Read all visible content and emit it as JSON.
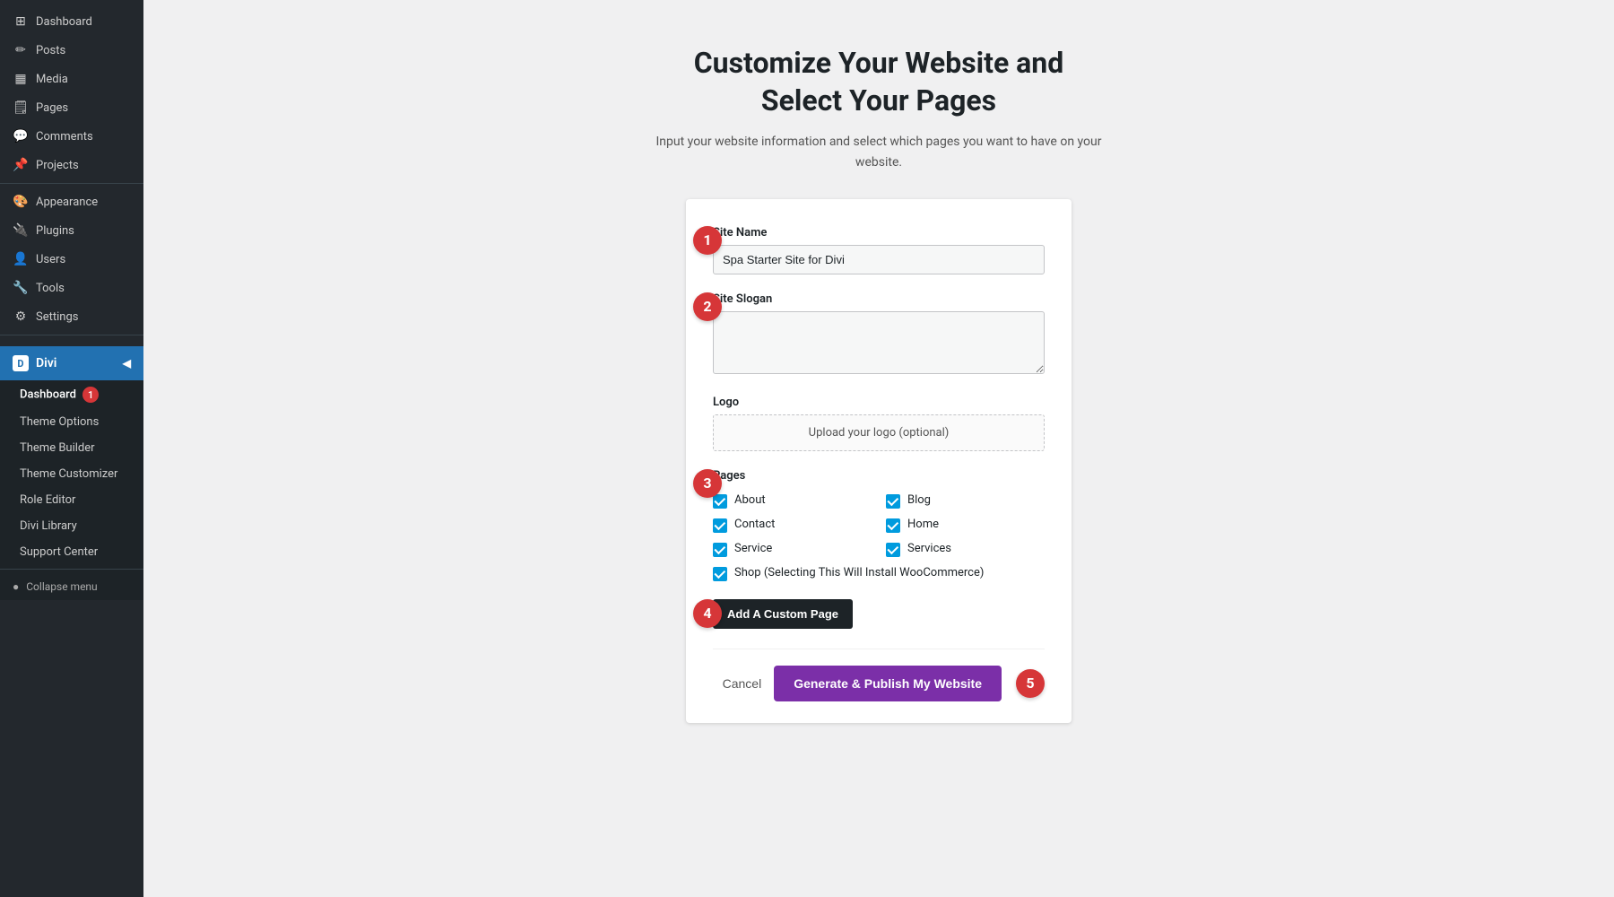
{
  "sidebar": {
    "items": [
      {
        "id": "dashboard",
        "label": "Dashboard",
        "icon": "⊞"
      },
      {
        "id": "posts",
        "label": "Posts",
        "icon": "✏"
      },
      {
        "id": "media",
        "label": "Media",
        "icon": "⬛"
      },
      {
        "id": "pages",
        "label": "Pages",
        "icon": "📄"
      },
      {
        "id": "comments",
        "label": "Comments",
        "icon": "💬"
      },
      {
        "id": "projects",
        "label": "Projects",
        "icon": "📌"
      },
      {
        "id": "appearance",
        "label": "Appearance",
        "icon": "🎨"
      },
      {
        "id": "plugins",
        "label": "Plugins",
        "icon": "🔌"
      },
      {
        "id": "users",
        "label": "Users",
        "icon": "👤"
      },
      {
        "id": "tools",
        "label": "Tools",
        "icon": "🔧"
      },
      {
        "id": "settings",
        "label": "Settings",
        "icon": "⚙"
      }
    ],
    "divi_label": "Divi",
    "divi_submenu": [
      {
        "id": "divi-dashboard",
        "label": "Dashboard",
        "badge": "1"
      },
      {
        "id": "theme-options",
        "label": "Theme Options"
      },
      {
        "id": "theme-builder",
        "label": "Theme Builder"
      },
      {
        "id": "theme-customizer",
        "label": "Theme Customizer"
      },
      {
        "id": "role-editor",
        "label": "Role Editor"
      },
      {
        "id": "divi-library",
        "label": "Divi Library"
      },
      {
        "id": "support-center",
        "label": "Support Center"
      }
    ],
    "collapse_label": "Collapse menu"
  },
  "page": {
    "title": "Customize Your Website and\nSelect Your Pages",
    "subtitle": "Input your website information and select which pages you want to have on your website."
  },
  "form": {
    "site_name_label": "Site Name",
    "site_name_value": "Spa Starter Site for Divi",
    "site_slogan_label": "Site Slogan",
    "site_slogan_placeholder": "",
    "logo_label": "Logo",
    "logo_upload_text": "Upload your logo (optional)",
    "pages_label": "Pages",
    "pages": [
      {
        "id": "about",
        "label": "About",
        "checked": true,
        "col": 1
      },
      {
        "id": "blog",
        "label": "Blog",
        "checked": true,
        "col": 2
      },
      {
        "id": "contact",
        "label": "Contact",
        "checked": true,
        "col": 1
      },
      {
        "id": "home",
        "label": "Home",
        "checked": true,
        "col": 2
      },
      {
        "id": "service",
        "label": "Service",
        "checked": true,
        "col": 1
      },
      {
        "id": "services",
        "label": "Services",
        "checked": true,
        "col": 2
      },
      {
        "id": "shop",
        "label": "Shop (Selecting This Will Install WooCommerce)",
        "checked": true,
        "col": "full"
      }
    ],
    "add_custom_page_label": "Add A Custom Page",
    "cancel_label": "Cancel",
    "publish_label": "Generate & Publish My Website"
  },
  "steps": {
    "step1": "1",
    "step2": "2",
    "step3": "3",
    "step4": "4",
    "step5": "5"
  }
}
